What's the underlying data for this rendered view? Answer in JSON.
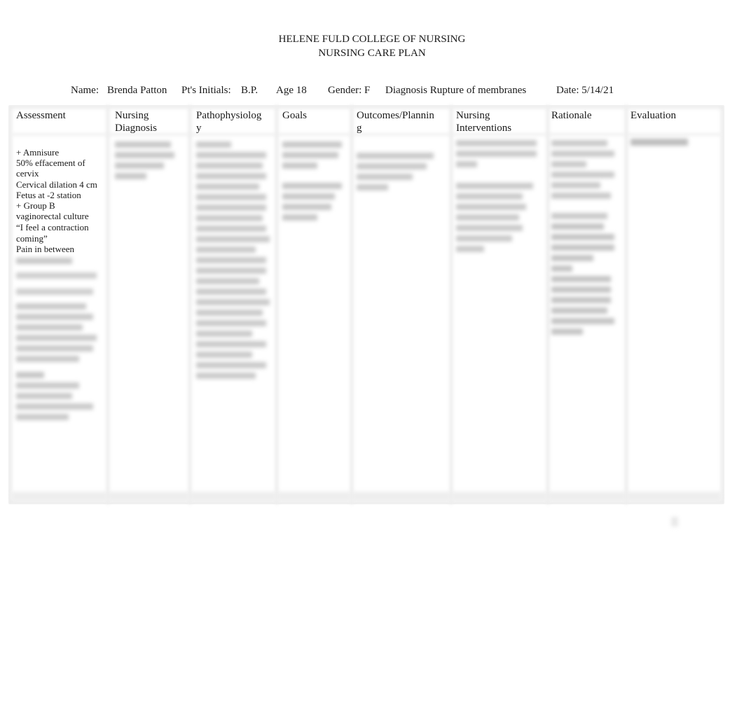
{
  "header": {
    "institution": "HELENE FULD COLLEGE OF NURSING",
    "document_title": "NURSING CARE PLAN"
  },
  "patient_info": {
    "name_label": "Name:",
    "name_value": "Brenda Patton",
    "initials_label": "Pt's Initials:",
    "initials_value": "B.P.",
    "age": "Age 18",
    "gender": "Gender: F",
    "diagnosis": "Diagnosis Rupture of membranes",
    "date": "Date: 5/14/21"
  },
  "table": {
    "columns": [
      {
        "label_line1": "Assessment",
        "label_line2": ""
      },
      {
        "label_line1": "Nursing",
        "label_line2": "Diagnosis"
      },
      {
        "label_line1": "Pathophysiolog",
        "label_line2": "y"
      },
      {
        "label_line1": "Goals",
        "label_line2": ""
      },
      {
        "label_line1": "Outcomes/Plannin",
        "label_line2": "g"
      },
      {
        "label_line1": "Nursing",
        "label_line2": "Interventions"
      },
      {
        "label_line1": "Rationale",
        "label_line2": ""
      },
      {
        "label_line1": "Evaluation",
        "label_line2": ""
      }
    ],
    "assessment_visible": [
      "+ Amnisure",
      "50% effacement of",
      "cervix",
      "Cervical dilation 4 cm",
      "Fetus at -2 station",
      "+ Group B",
      "vaginorectal culture",
      "“I feel a contraction",
      "coming”",
      "Pain in between"
    ],
    "blurred_placeholder": "content obscured"
  }
}
